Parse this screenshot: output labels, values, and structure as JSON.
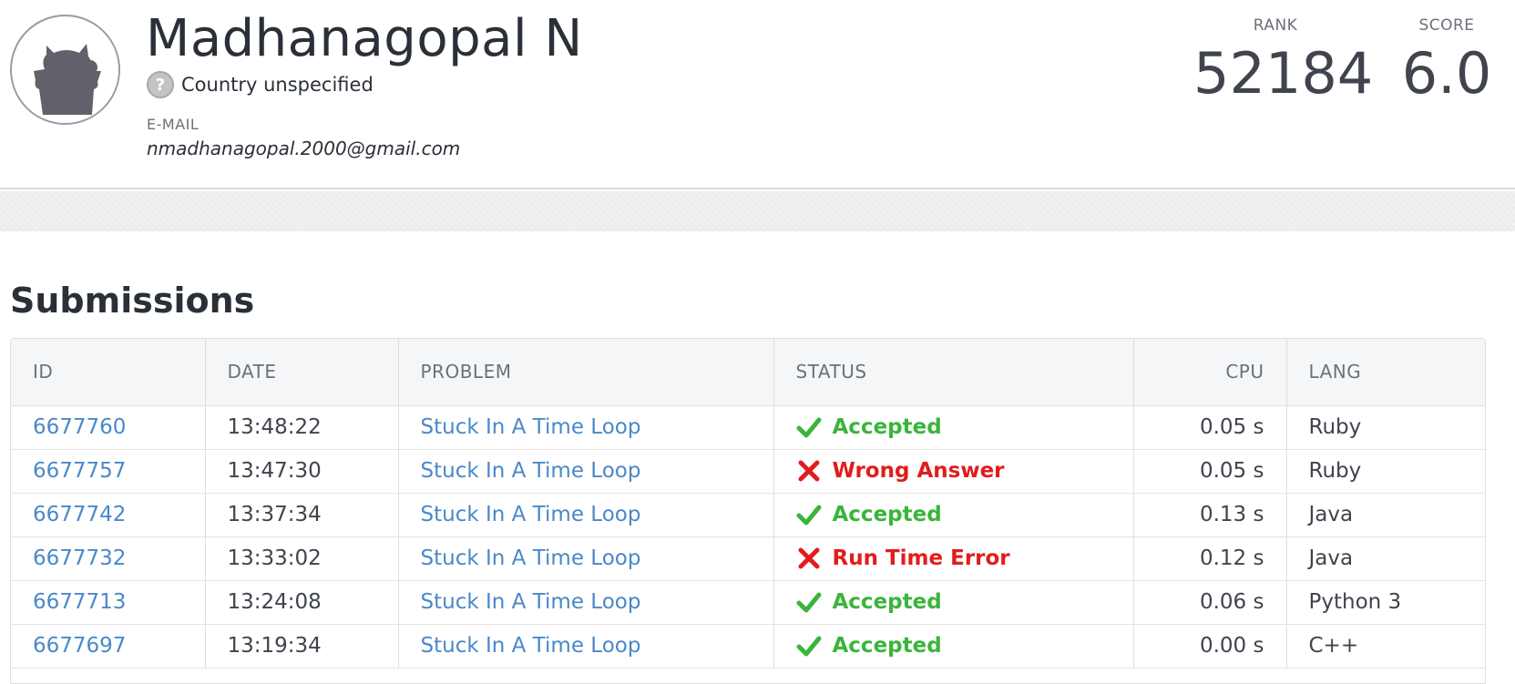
{
  "profile": {
    "name": "Madhanagopal N",
    "country": "Country unspecified",
    "email_label": "E-MAIL",
    "email": "nmadhanagopal.2000@gmail.com",
    "rank_label": "RANK",
    "rank": "52184",
    "score_label": "SCORE",
    "score": "6.0"
  },
  "submissions": {
    "title": "Submissions",
    "columns": [
      "ID",
      "DATE",
      "PROBLEM",
      "STATUS",
      "CPU",
      "LANG"
    ],
    "rows": [
      {
        "id": "6677760",
        "date": "13:48:22",
        "problem": "Stuck In A Time Loop",
        "status": "Accepted",
        "ok": true,
        "cpu": "0.05 s",
        "lang": "Ruby"
      },
      {
        "id": "6677757",
        "date": "13:47:30",
        "problem": "Stuck In A Time Loop",
        "status": "Wrong Answer",
        "ok": false,
        "cpu": "0.05 s",
        "lang": "Ruby"
      },
      {
        "id": "6677742",
        "date": "13:37:34",
        "problem": "Stuck In A Time Loop",
        "status": "Accepted",
        "ok": true,
        "cpu": "0.13 s",
        "lang": "Java"
      },
      {
        "id": "6677732",
        "date": "13:33:02",
        "problem": "Stuck In A Time Loop",
        "status": "Run Time Error",
        "ok": false,
        "cpu": "0.12 s",
        "lang": "Java"
      },
      {
        "id": "6677713",
        "date": "13:24:08",
        "problem": "Stuck In A Time Loop",
        "status": "Accepted",
        "ok": true,
        "cpu": "0.06 s",
        "lang": "Python 3"
      },
      {
        "id": "6677697",
        "date": "13:19:34",
        "problem": "Stuck In A Time Loop",
        "status": "Accepted",
        "ok": true,
        "cpu": "0.00 s",
        "lang": "C++"
      }
    ]
  },
  "colors": {
    "accepted": "#3ab53a",
    "rejected": "#e21c1c",
    "link": "#4a88c9"
  },
  "icons": {
    "accepted": "checkmark-icon",
    "rejected": "cross-icon",
    "country": "question-mark-icon"
  }
}
